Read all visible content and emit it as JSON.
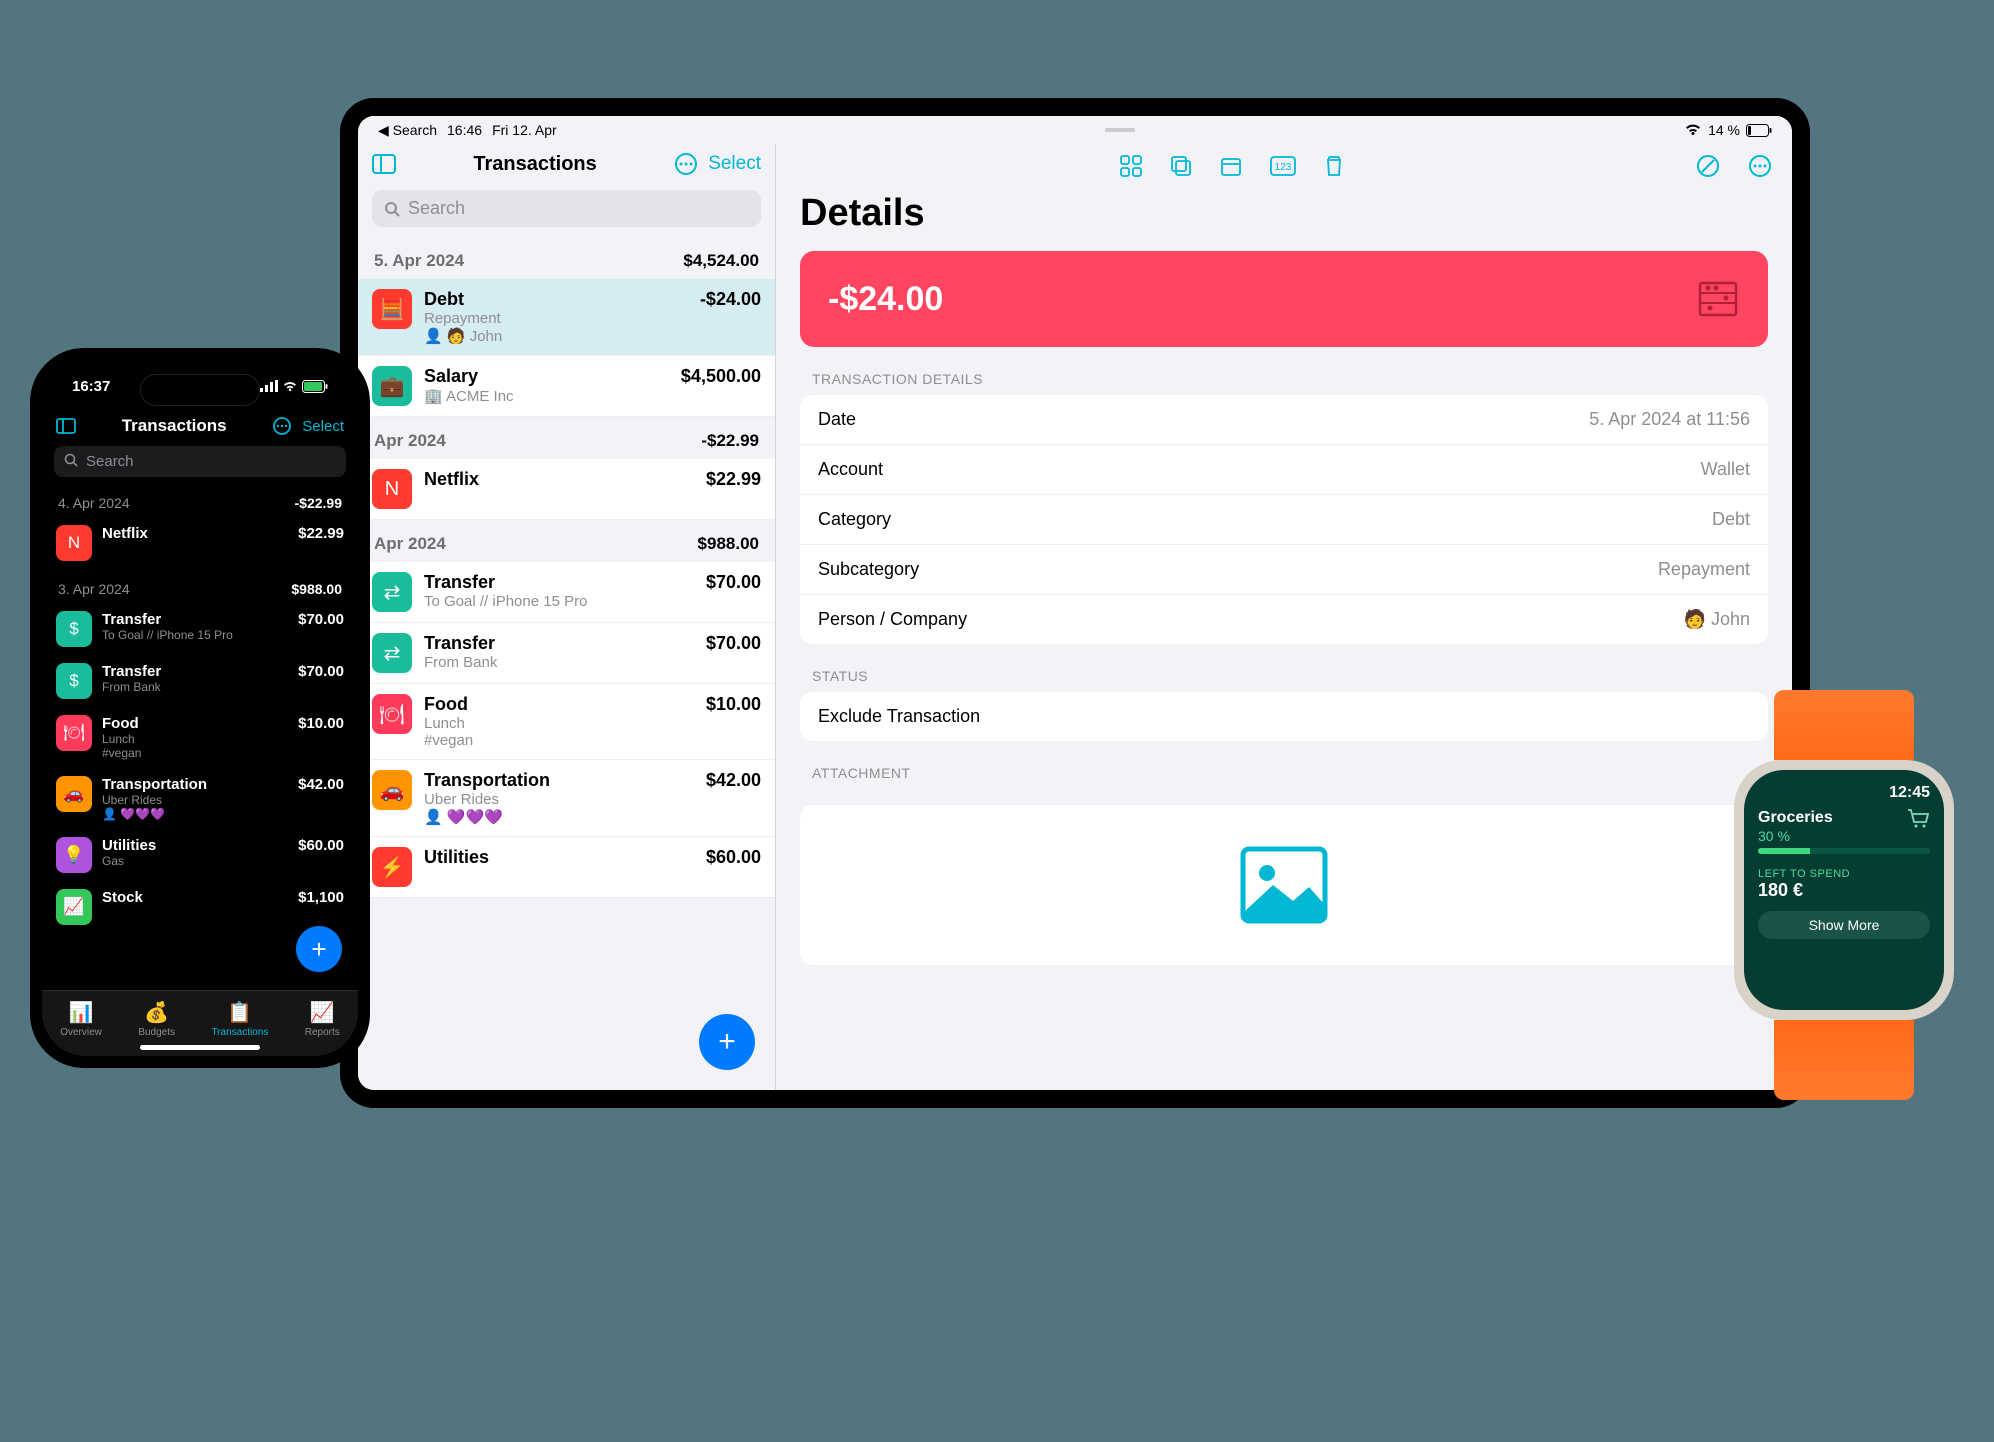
{
  "ipad": {
    "status": {
      "back": "◀ Search",
      "time": "16:46",
      "date": "Fri 12. Apr",
      "battery": "14 %"
    },
    "sidebar": {
      "title": "Transactions",
      "select": "Select",
      "search_placeholder": "Search",
      "groups": [
        {
          "date": "5. Apr 2024",
          "total": "$4,524.00",
          "items": [
            {
              "title": "Debt",
              "sub": "Repayment",
              "person": "John",
              "amount": "-$24.00",
              "selected": true,
              "color": "ic-red",
              "icon": "🧮"
            },
            {
              "title": "Salary",
              "sub": "🏢 ACME Inc",
              "amount": "$4,500.00",
              "color": "ic-teal",
              "icon": "💼"
            }
          ]
        },
        {
          "date": "Apr 2024",
          "total": "-$22.99",
          "items": [
            {
              "title": "Netflix",
              "amount": "$22.99",
              "color": "ic-red",
              "icon": "N"
            }
          ]
        },
        {
          "date": "Apr 2024",
          "total": "$988.00",
          "items": [
            {
              "title": "Transfer",
              "sub": "To Goal // iPhone 15 Pro",
              "amount": "$70.00",
              "color": "ic-teal",
              "icon": "⇄"
            },
            {
              "title": "Transfer",
              "sub": "From Bank",
              "amount": "$70.00",
              "color": "ic-teal",
              "icon": "⇄"
            },
            {
              "title": "Food",
              "sub": "Lunch",
              "tag": "#vegan",
              "amount": "$10.00",
              "color": "ic-pink",
              "icon": "🍽"
            },
            {
              "title": "Transportation",
              "sub": "Uber Rides",
              "extra": "👤 💜💜💜",
              "amount": "$42.00",
              "color": "ic-orange",
              "icon": "🚗"
            },
            {
              "title": "Utilities",
              "amount": "$60.00",
              "color": "ic-red",
              "icon": "⚡"
            }
          ]
        }
      ]
    },
    "detail": {
      "title": "Details",
      "amount": "-$24.00",
      "section1_label": "TRANSACTION DETAILS",
      "rows": [
        {
          "key": "Date",
          "val": "5. Apr 2024 at 11:56"
        },
        {
          "key": "Account",
          "val": "Wallet"
        },
        {
          "key": "Category",
          "val": "Debt"
        },
        {
          "key": "Subcategory",
          "val": "Repayment"
        },
        {
          "key": "Person / Company",
          "val": "🧑 John"
        }
      ],
      "status_label": "STATUS",
      "exclude": "Exclude Transaction",
      "attach_label": "ATTACHMENT"
    }
  },
  "iphone": {
    "status_time": "16:37",
    "title": "Transactions",
    "select": "Select",
    "search_placeholder": "Search",
    "groups": [
      {
        "date": "4. Apr 2024",
        "total": "-$22.99",
        "items": [
          {
            "title": "Netflix",
            "amount": "$22.99",
            "color": "ic-red",
            "icon": "N"
          }
        ]
      },
      {
        "date": "3. Apr 2024",
        "total": "$988.00",
        "items": [
          {
            "title": "Transfer",
            "sub": "To Goal // iPhone 15 Pro",
            "amount": "$70.00",
            "color": "ic-teal",
            "icon": "$"
          },
          {
            "title": "Transfer",
            "sub": "From Bank",
            "amount": "$70.00",
            "color": "ic-teal",
            "icon": "$"
          },
          {
            "title": "Food",
            "sub": "Lunch",
            "tag": "#vegan",
            "amount": "$10.00",
            "color": "ic-pink",
            "icon": "🍽"
          },
          {
            "title": "Transportation",
            "sub": "Uber Rides",
            "extra": "👤 💜💜💜",
            "amount": "$42.00",
            "color": "ic-orange",
            "icon": "🚗"
          },
          {
            "title": "Utilities",
            "sub": "Gas",
            "amount": "$60.00",
            "color": "ic-purple",
            "icon": "💡"
          },
          {
            "title": "Stock",
            "amount": "$1,100",
            "color": "ic-green",
            "icon": "📈"
          }
        ]
      }
    ],
    "tabs": [
      {
        "label": "Overview",
        "icon": "📊"
      },
      {
        "label": "Budgets",
        "icon": "💰"
      },
      {
        "label": "Transactions",
        "icon": "📋",
        "active": true
      },
      {
        "label": "Reports",
        "icon": "📈"
      }
    ]
  },
  "watch": {
    "time": "12:45",
    "title": "Groceries",
    "pct": "30 %",
    "pct_value": 30,
    "left_label": "LEFT TO SPEND",
    "amount": "180 €",
    "button": "Show More"
  }
}
